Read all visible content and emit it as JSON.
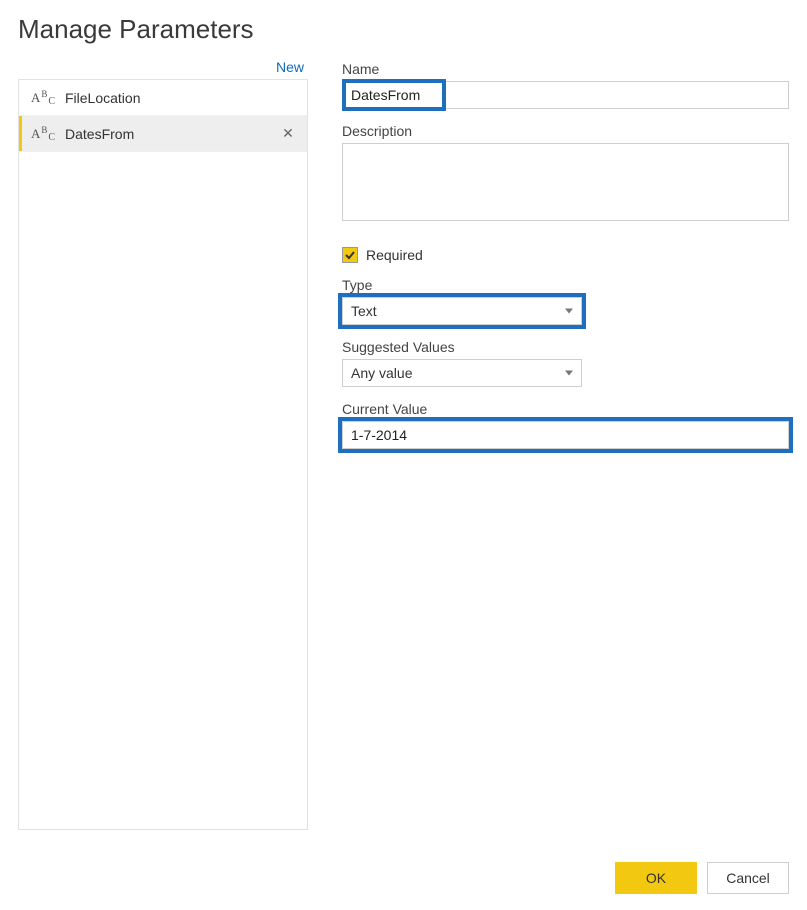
{
  "dialog": {
    "title": "Manage Parameters",
    "new_label": "New"
  },
  "params": [
    {
      "type_icon": "text",
      "name": "FileLocation",
      "selected": false
    },
    {
      "type_icon": "text",
      "name": "DatesFrom",
      "selected": true
    }
  ],
  "form": {
    "name_label": "Name",
    "name_value": "DatesFrom",
    "description_label": "Description",
    "description_value": "",
    "required_label": "Required",
    "required_checked": true,
    "type_label": "Type",
    "type_value": "Text",
    "suggested_label": "Suggested Values",
    "suggested_value": "Any value",
    "current_label": "Current Value",
    "current_value": "1-7-2014"
  },
  "buttons": {
    "ok": "OK",
    "cancel": "Cancel"
  },
  "colors": {
    "accent_yellow": "#f2c811",
    "highlight_blue": "#1f6fc0",
    "link_blue": "#0f6cbd"
  }
}
